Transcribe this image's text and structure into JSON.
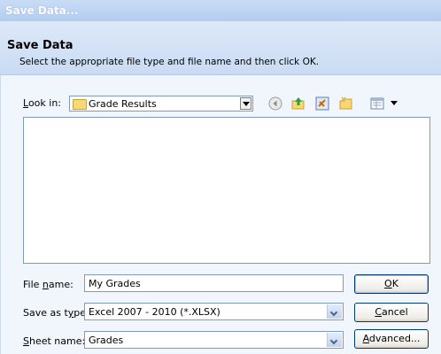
{
  "window": {
    "title": "Save Data..."
  },
  "header": {
    "title": "Save Data",
    "subtitle": "Select the appropriate file type and file name and then click OK."
  },
  "look_in": {
    "label_u": "L",
    "label_rest": "ook in:",
    "value": "Grade Results"
  },
  "toolbar": {
    "icons": [
      "back-icon",
      "up-folder-icon",
      "delete-icon",
      "new-folder-icon",
      "views-icon"
    ]
  },
  "fields": {
    "file_name": {
      "label_pre": "File ",
      "label_u": "n",
      "label_post": "ame:",
      "value": "My Grades"
    },
    "save_as_type": {
      "label_pre": "Save as t",
      "label_u": "y",
      "label_post": "pe:",
      "value": "Excel 2007 - 2010 (*.XLSX)"
    },
    "sheet_name": {
      "label_pre": "",
      "label_u": "S",
      "label_post": "heet name:",
      "value": "Grades"
    }
  },
  "buttons": {
    "ok": {
      "u": "O",
      "rest": "K"
    },
    "cancel": {
      "u": "C",
      "rest": "ancel"
    },
    "advanced": {
      "u": "A",
      "rest": "dvanced..."
    }
  }
}
